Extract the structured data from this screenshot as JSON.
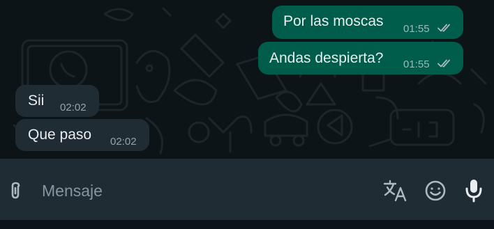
{
  "messages": [
    {
      "direction": "outgoing",
      "text": "Por las moscas",
      "time": "01:55",
      "status": "read"
    },
    {
      "direction": "outgoing",
      "text": "Andas despierta?",
      "time": "01:55",
      "status": "read"
    },
    {
      "direction": "incoming",
      "text": "Sii",
      "time": "02:02"
    },
    {
      "direction": "incoming",
      "text": "Que paso",
      "time": "02:02"
    }
  ],
  "composer": {
    "placeholder": "Mensaje",
    "icons": [
      "attach-icon",
      "translate-icon",
      "emoji-icon",
      "microphone-icon"
    ]
  },
  "colors": {
    "background": "#0d1418",
    "outgoing_bubble": "#005c4b",
    "incoming_bubble": "#202c33",
    "input_bar": "#1f2c34",
    "icon": "#aebac1"
  }
}
